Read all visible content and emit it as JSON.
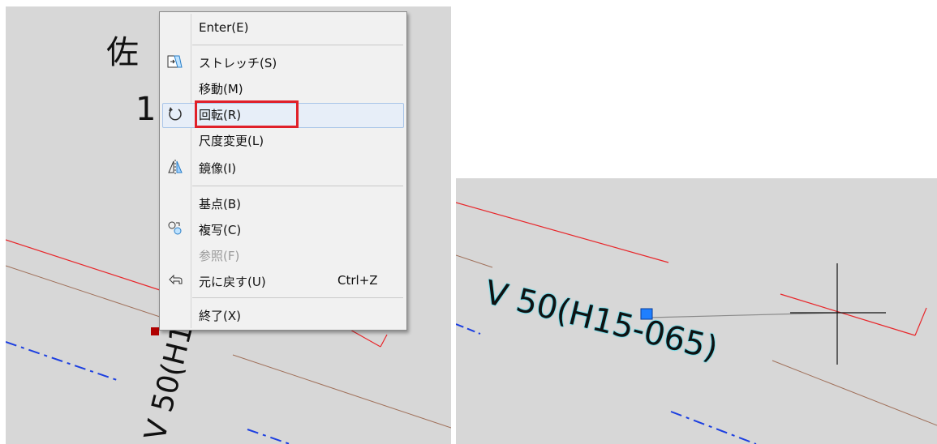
{
  "left_view": {
    "title_char": "佐",
    "digit": "1",
    "rotated_label": "V 50(H1"
  },
  "right_view": {
    "label": "V 50(H15-065)"
  },
  "context_menu": {
    "items": [
      {
        "label": "Enter(E)",
        "icon": "none",
        "shortcut": ""
      },
      {
        "label": "ストレッチ(S)",
        "icon": "stretch-icon",
        "shortcut": ""
      },
      {
        "label": "移動(M)",
        "icon": "none",
        "shortcut": ""
      },
      {
        "label": "回転(R)",
        "icon": "rotate-icon",
        "shortcut": "",
        "highlighted": true
      },
      {
        "label": "尺度変更(L)",
        "icon": "none",
        "shortcut": ""
      },
      {
        "label": "鏡像(I)",
        "icon": "mirror-icon",
        "shortcut": ""
      },
      {
        "label": "基点(B)",
        "icon": "none",
        "shortcut": ""
      },
      {
        "label": "複写(C)",
        "icon": "copy-icon",
        "shortcut": ""
      },
      {
        "label": "参照(F)",
        "icon": "none",
        "shortcut": "",
        "disabled": true
      },
      {
        "label": "元に戻す(U)",
        "icon": "undo-icon",
        "shortcut": "Ctrl+Z"
      },
      {
        "label": "終了(X)",
        "icon": "none",
        "shortcut": ""
      }
    ]
  },
  "colors": {
    "canvas_bg": "#d7d7d7",
    "red_line": "#e8262a",
    "brown_line": "#a0705a",
    "blue_dash": "#1c3fe0",
    "grip_blue": "#1f7fff",
    "grip_red": "#b00000",
    "annotation_red": "#e0202a",
    "text_glow": "#00e0ff"
  }
}
